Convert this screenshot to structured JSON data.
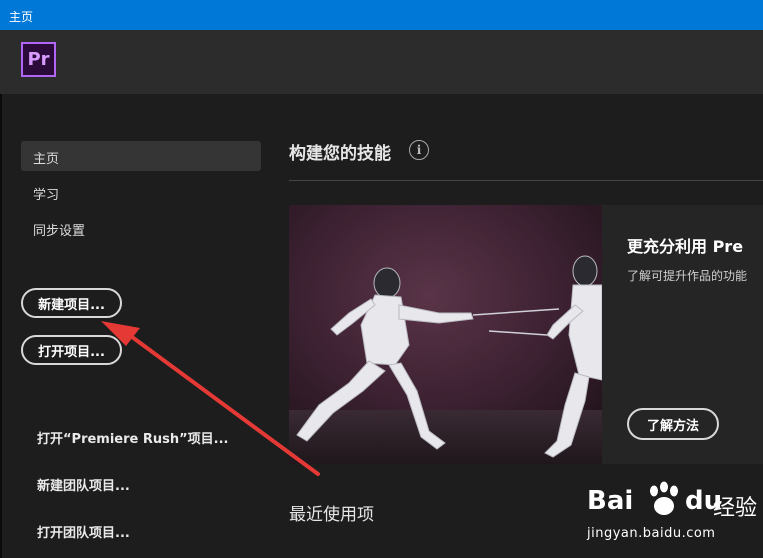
{
  "window": {
    "title": "主页"
  },
  "header": {
    "logo_text": "Pr"
  },
  "sidebar": {
    "nav": [
      {
        "label": "主页",
        "active": true
      },
      {
        "label": "学习",
        "active": false
      },
      {
        "label": "同步设置",
        "active": false
      }
    ],
    "buttons": {
      "new_project": "新建项目...",
      "open_project": "打开项目..."
    },
    "links": {
      "open_rush": "打开“Premiere Rush”项目...",
      "new_team": "新建团队项目...",
      "open_team": "打开团队项目..."
    }
  },
  "main": {
    "section_title": "构建您的技能",
    "info_icon": "i",
    "card": {
      "title": "更充分利用 Pre",
      "description": "了解可提升作品的功能",
      "button_label": "了解方法"
    },
    "recent_title": "最近使用项"
  },
  "watermark": {
    "brand_left": "Bai",
    "brand_right": "du",
    "brand_cn": "经验",
    "url": "jingyan.baidu.com"
  },
  "colors": {
    "titlebar": "#0078d7",
    "accent_logo": "#b266f5",
    "annotation_arrow": "#e53935"
  }
}
